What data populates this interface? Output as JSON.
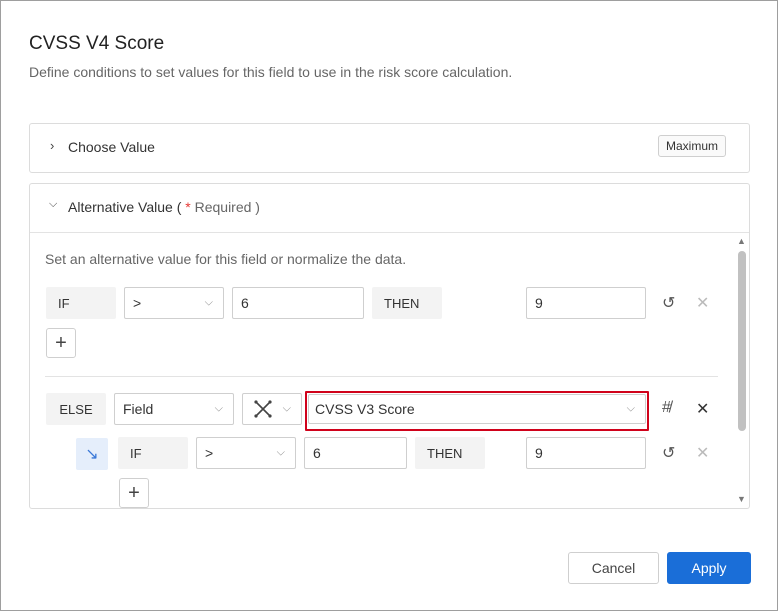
{
  "dialog": {
    "title": "CVSS V4 Score",
    "subtitle": "Define conditions to set values for this field to use in the risk score calculation."
  },
  "choose_value": {
    "label": "Choose Value",
    "badge": "Maximum"
  },
  "alternative_value": {
    "label": "Alternative Value (",
    "required_star": "*",
    "required_text": "Required )",
    "description": "Set an alternative value for this field or normalize the data."
  },
  "rule1": {
    "if_label": "IF",
    "operator": ">",
    "value": "6",
    "then_label": "THEN",
    "result": "9"
  },
  "else_row": {
    "else_label": "ELSE",
    "type_select": "Field",
    "field_select": "CVSS V3 Score"
  },
  "rule2": {
    "if_label": "IF",
    "operator": ">",
    "value": "6",
    "then_label": "THEN",
    "result": "9"
  },
  "footer": {
    "cancel_label": "Cancel",
    "apply_label": "Apply"
  },
  "colors": {
    "primary": "#1a6ed8",
    "highlight": "#d0021b",
    "required": "#e53935"
  },
  "icons": [
    "chevron-right-icon",
    "chevron-down-icon",
    "history-icon",
    "close-icon",
    "plus-icon",
    "shuffle-icon",
    "hash-off-icon",
    "arrow-down-right-icon"
  ]
}
